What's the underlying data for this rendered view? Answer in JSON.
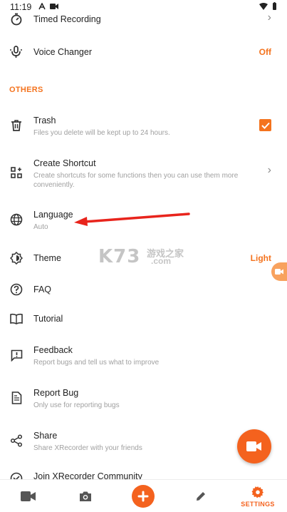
{
  "status_bar": {
    "time": "11:19"
  },
  "rows": {
    "timed_recording": {
      "title": "Timed Recording"
    },
    "voice_changer": {
      "title": "Voice Changer",
      "value": "Off"
    },
    "trash": {
      "title": "Trash",
      "subtitle": "Files you delete will be kept up to 24 hours.",
      "checked": true
    },
    "create_shortcut": {
      "title": "Create Shortcut",
      "subtitle": "Create shortcuts for some functions then you can use them more conveniently."
    },
    "language": {
      "title": "Language",
      "subtitle": "Auto"
    },
    "theme": {
      "title": "Theme",
      "value": "Light"
    },
    "faq": {
      "title": "FAQ"
    },
    "tutorial": {
      "title": "Tutorial"
    },
    "feedback": {
      "title": "Feedback",
      "subtitle": "Report bugs and tell us what to improve"
    },
    "report_bug": {
      "title": "Report Bug",
      "subtitle": "Only use for reporting bugs"
    },
    "share": {
      "title": "Share",
      "subtitle": "Share XRecorder with your friends"
    },
    "join_community": {
      "title": "Join XRecorder Community"
    }
  },
  "sections": {
    "others": "OTHERS"
  },
  "watermark": {
    "main": "K73",
    "sub": "游戏之家",
    "domain": ".com"
  },
  "bottom_nav": {
    "settings_label": "SETTINGS"
  },
  "colors": {
    "accent": "#f4731e",
    "annotation_arrow": "#e8241c"
  }
}
